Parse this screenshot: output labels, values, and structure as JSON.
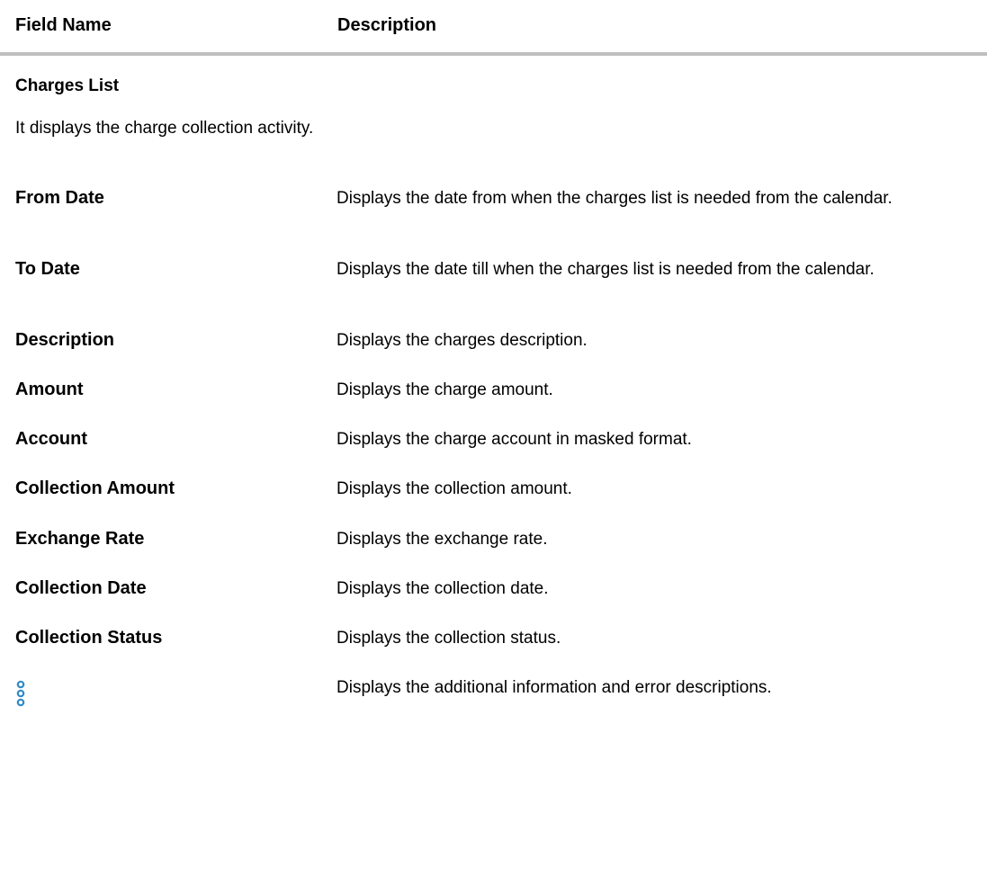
{
  "table_header": {
    "field_name": "Field Name",
    "description": "Description"
  },
  "section": {
    "title": "Charges List",
    "description": "It displays the charge collection activity."
  },
  "rows": [
    {
      "field": "From Date",
      "description": "Displays the date from when the charges list is needed from the calendar."
    },
    {
      "field": "To Date",
      "description": "Displays the date till when the charges list is needed from the calendar."
    },
    {
      "field": "Description",
      "description": "Displays the charges description."
    },
    {
      "field": "Amount",
      "description": "Displays the charge amount."
    },
    {
      "field": "Account",
      "description": "Displays the charge account in masked format."
    },
    {
      "field": "Collection Amount",
      "description": "Displays the collection amount."
    },
    {
      "field": "Exchange Rate",
      "description": "Displays the exchange rate."
    },
    {
      "field": "Collection Date",
      "description": "Displays the collection date."
    },
    {
      "field": "Collection Status",
      "description": "Displays the collection status."
    },
    {
      "icon": "vertical-ellipsis-icon",
      "description": "Displays the additional information and error descriptions."
    }
  ],
  "colors": {
    "header_rule": "#bfbfbf",
    "icon_blue": "#2f8ac8"
  }
}
